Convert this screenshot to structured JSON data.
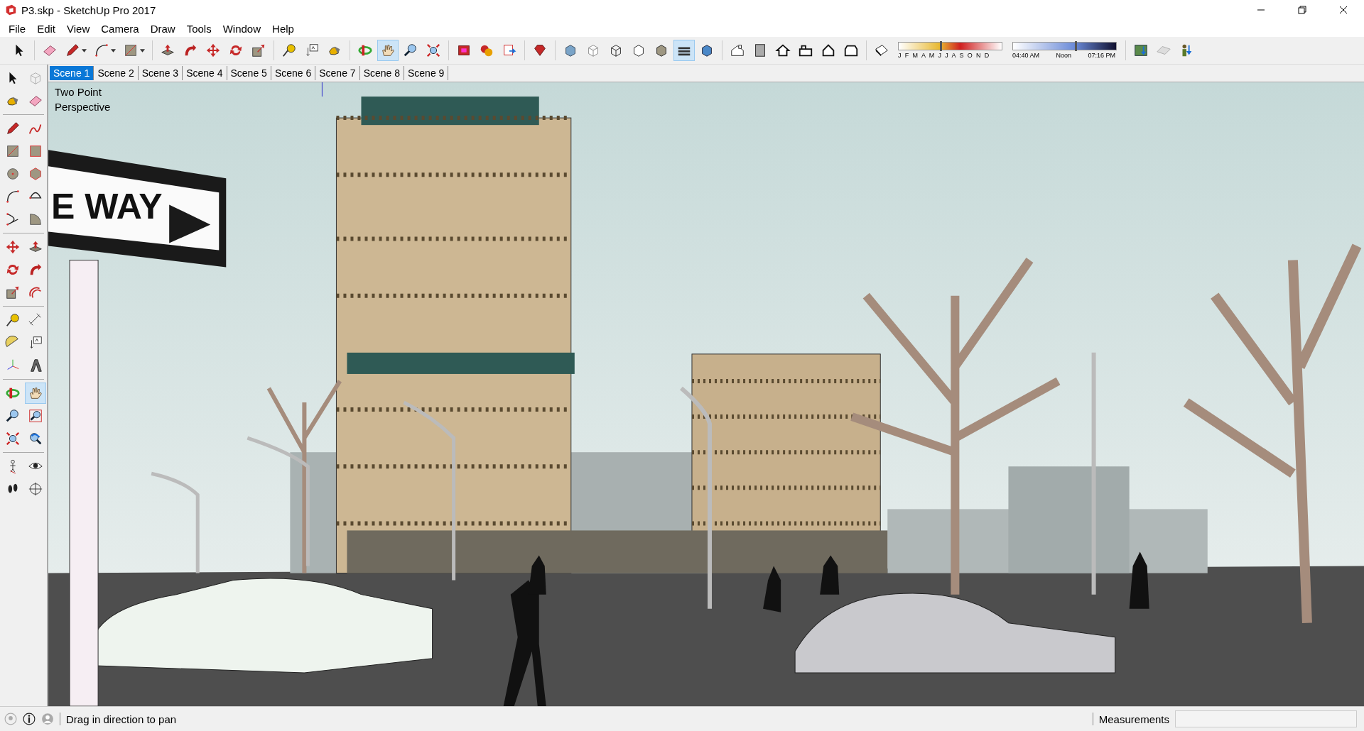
{
  "window": {
    "title": "P3.skp - SketchUp Pro 2017"
  },
  "menu": [
    "File",
    "Edit",
    "View",
    "Camera",
    "Draw",
    "Tools",
    "Window",
    "Help"
  ],
  "toolbar": {
    "groups": [
      [
        {
          "kind": "select",
          "selected": false,
          "menu": false
        }
      ],
      [
        {
          "kind": "eraser",
          "selected": false,
          "menu": false
        },
        {
          "kind": "pencil",
          "selected": false,
          "menu": true
        },
        {
          "kind": "arc",
          "selected": false,
          "menu": true
        },
        {
          "kind": "rect",
          "selected": false,
          "menu": true
        }
      ],
      [
        {
          "kind": "pushpull",
          "selected": false,
          "menu": false
        },
        {
          "kind": "followme",
          "selected": false,
          "menu": false
        },
        {
          "kind": "move",
          "selected": false,
          "menu": false
        },
        {
          "kind": "rotate",
          "selected": false,
          "menu": false
        },
        {
          "kind": "scale",
          "selected": false,
          "menu": false
        }
      ],
      [
        {
          "kind": "tape",
          "selected": false,
          "menu": false
        },
        {
          "kind": "text",
          "selected": false,
          "menu": false
        },
        {
          "kind": "paint",
          "selected": false,
          "menu": false
        }
      ],
      [
        {
          "kind": "orbit",
          "selected": false,
          "menu": false
        },
        {
          "kind": "pan",
          "selected": true,
          "menu": false
        },
        {
          "kind": "zoom",
          "selected": false,
          "menu": false
        },
        {
          "kind": "extents",
          "selected": false,
          "menu": false
        }
      ],
      [
        {
          "kind": "warehouse",
          "selected": false,
          "menu": false
        },
        {
          "kind": "extension",
          "selected": false,
          "menu": false
        },
        {
          "kind": "share",
          "selected": false,
          "menu": false
        }
      ],
      [
        {
          "kind": "ruby",
          "selected": false,
          "menu": false
        }
      ],
      [
        {
          "kind": "xray",
          "selected": false,
          "menu": false
        },
        {
          "kind": "backedges",
          "selected": false,
          "menu": false
        },
        {
          "kind": "wire",
          "selected": false,
          "menu": false
        },
        {
          "kind": "hidden",
          "selected": false,
          "menu": false
        },
        {
          "kind": "shaded",
          "selected": false,
          "menu": false
        },
        {
          "kind": "textured",
          "selected": true,
          "menu": false
        },
        {
          "kind": "mono",
          "selected": false,
          "menu": false
        }
      ],
      [
        {
          "kind": "iso",
          "selected": false,
          "menu": false
        },
        {
          "kind": "top",
          "selected": false,
          "menu": false
        },
        {
          "kind": "front",
          "selected": false,
          "menu": false
        },
        {
          "kind": "right",
          "selected": false,
          "menu": false
        },
        {
          "kind": "back",
          "selected": false,
          "menu": false
        },
        {
          "kind": "left",
          "selected": false,
          "menu": false
        }
      ]
    ]
  },
  "shadows": {
    "months": "J F M A M J J A S O N D",
    "date_slider": {
      "level": 0.41
    },
    "time_start": "04:40 AM",
    "time_mid": "Noon",
    "time_end": "07:16 PM",
    "time_slider": {
      "level": 0.61
    }
  },
  "location_tools": [
    {
      "kind": "map",
      "selected": false
    },
    {
      "kind": "terrain",
      "selected": false
    },
    {
      "kind": "figure",
      "selected": false
    }
  ],
  "scene_tabs": [
    {
      "label": "Scene 1",
      "selected": true
    },
    {
      "label": "Scene 2",
      "selected": false
    },
    {
      "label": "Scene 3",
      "selected": false
    },
    {
      "label": "Scene 4",
      "selected": false
    },
    {
      "label": "Scene 5",
      "selected": false
    },
    {
      "label": "Scene 6",
      "selected": false
    },
    {
      "label": "Scene 7",
      "selected": false
    },
    {
      "label": "Scene 8",
      "selected": false
    },
    {
      "label": "Scene 9",
      "selected": false
    }
  ],
  "left_toolbar": {
    "groups": [
      [
        {
          "kind": "select",
          "selected": false
        },
        {
          "kind": "component",
          "selected": false
        },
        {
          "kind": "paint",
          "selected": false
        },
        {
          "kind": "eraser",
          "selected": false
        }
      ],
      [
        {
          "kind": "pencil",
          "selected": false
        },
        {
          "kind": "freehand",
          "selected": false
        },
        {
          "kind": "rect",
          "selected": false
        },
        {
          "kind": "rotrect",
          "selected": false
        },
        {
          "kind": "circle",
          "selected": false
        },
        {
          "kind": "polygon",
          "selected": false
        },
        {
          "kind": "arc",
          "selected": false
        },
        {
          "kind": "arc2",
          "selected": false
        },
        {
          "kind": "arc3",
          "selected": false
        },
        {
          "kind": "pie",
          "selected": false
        }
      ],
      [
        {
          "kind": "move",
          "selected": false
        },
        {
          "kind": "pushpull",
          "selected": false
        },
        {
          "kind": "rotate",
          "selected": false
        },
        {
          "kind": "followme",
          "selected": false
        },
        {
          "kind": "scale",
          "selected": false
        },
        {
          "kind": "offset",
          "selected": false
        }
      ],
      [
        {
          "kind": "tape",
          "selected": false
        },
        {
          "kind": "dimension",
          "selected": false
        },
        {
          "kind": "protractor",
          "selected": false
        },
        {
          "kind": "text",
          "selected": false
        },
        {
          "kind": "axes",
          "selected": false
        },
        {
          "kind": "text3d",
          "selected": false
        }
      ],
      [
        {
          "kind": "orbit",
          "selected": false
        },
        {
          "kind": "pan",
          "selected": true
        },
        {
          "kind": "zoom",
          "selected": false
        },
        {
          "kind": "zoomwin",
          "selected": false
        },
        {
          "kind": "extents",
          "selected": false
        },
        {
          "kind": "previous",
          "selected": false
        }
      ],
      [
        {
          "kind": "walk",
          "selected": false
        },
        {
          "kind": "look",
          "selected": false
        },
        {
          "kind": "footprints",
          "selected": false
        },
        {
          "kind": "section",
          "selected": false
        }
      ]
    ]
  },
  "viewport": {
    "view_label": "Two Point Perspective",
    "sign_text": "E WAY"
  },
  "status_bar": {
    "message": "Drag in direction to pan",
    "measurements_label": "Measurements"
  }
}
